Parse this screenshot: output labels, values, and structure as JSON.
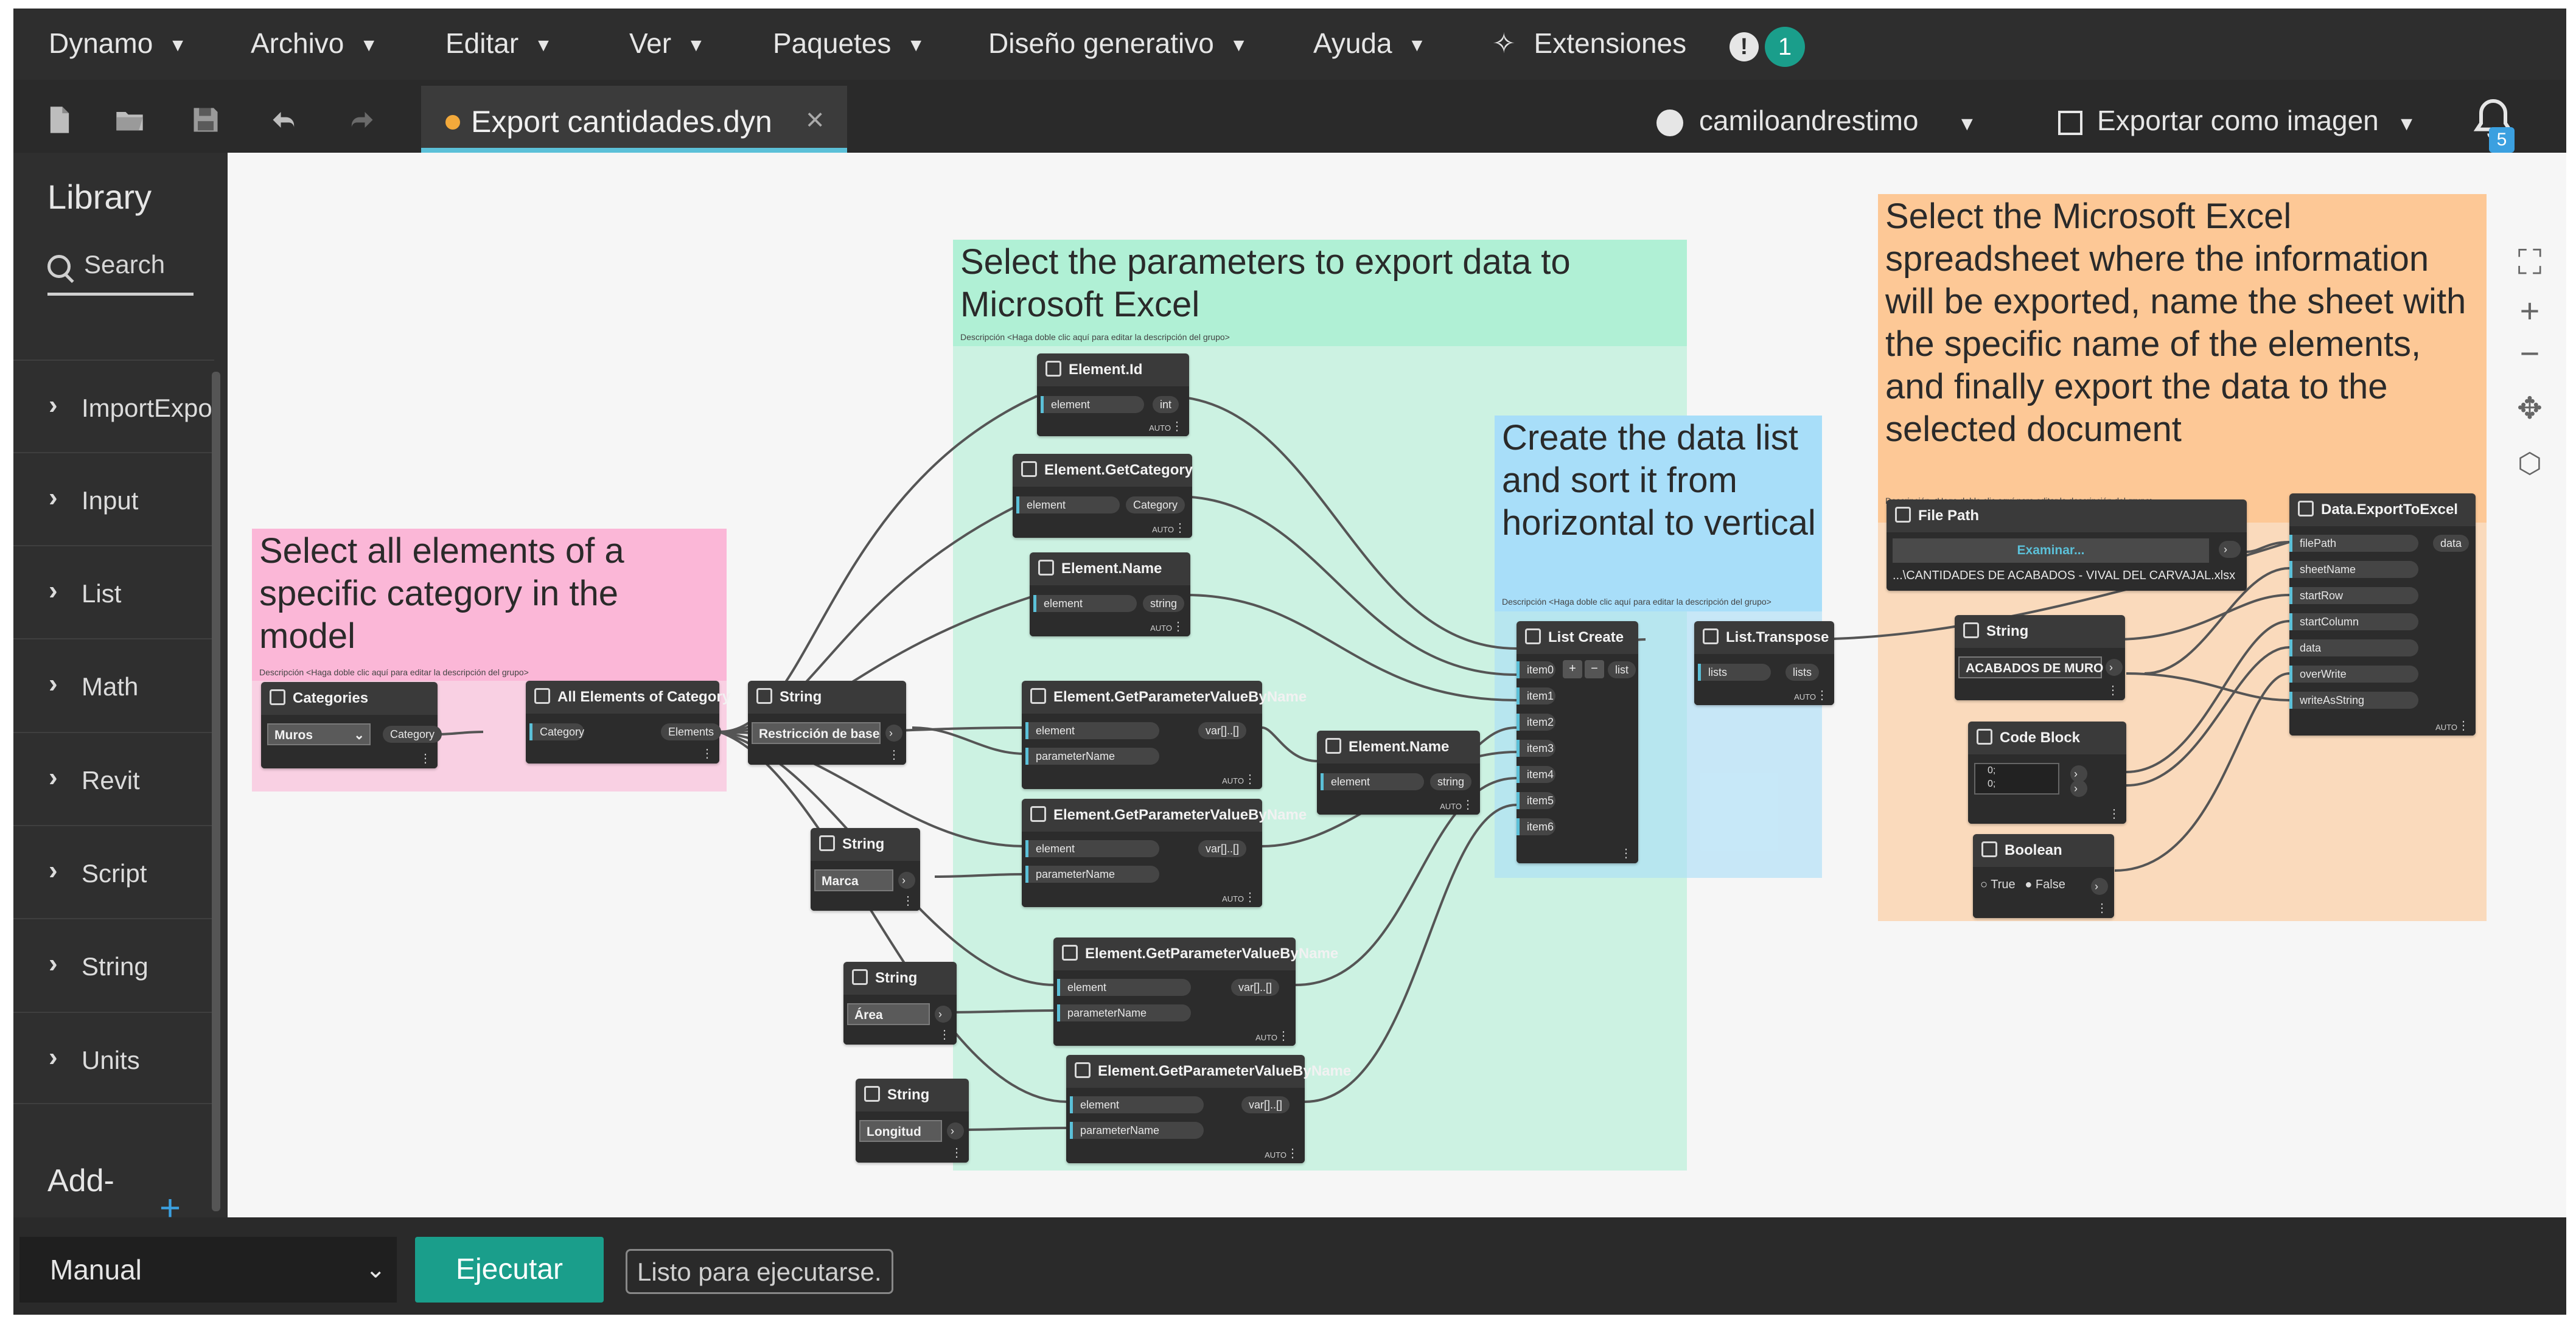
{
  "menu": {
    "items": [
      "Dynamo",
      "Archivo",
      "Editar",
      "Ver",
      "Paquetes",
      "Diseño generativo",
      "Ayuda"
    ],
    "extensions": "Extensiones",
    "alert_count": "1"
  },
  "toolbar": {
    "tab_title": "Export cantidades.dyn",
    "tab_close": "×",
    "user": "camiloandrestimo",
    "export_label": "Exportar como imagen",
    "notification_count": "5"
  },
  "library": {
    "title": "Library",
    "search_placeholder": "Search",
    "items": [
      "ImportExport",
      "Input",
      "List",
      "Math",
      "Revit",
      "Script",
      "String",
      "Units"
    ],
    "addons": "Add-"
  },
  "groups": {
    "select_category": {
      "title": "Select all elements of a specific category in the model",
      "desc": "Descripción <Haga doble clic aquí para editar la descripción del grupo>",
      "color": "#fbb7d7"
    },
    "parameters": {
      "title": "Select the parameters to export data to Microsoft Excel",
      "desc": "Descripción <Haga doble clic aquí para editar la descripción del grupo>",
      "color": "#b0f0d5"
    },
    "data_list": {
      "title": "Create the data list and sort it from horizontal to vertical",
      "desc": "Descripción <Haga doble clic aquí para editar la descripción del grupo>",
      "color": "#a8def9"
    },
    "excel": {
      "title": "Select the Microsoft Excel spreadsheet where the information will be exported, name the sheet with the specific name of the elements, and finally export the data to the selected document",
      "desc": "Descripción <Haga doble clic aquí para editar la descripción del grupo>",
      "color": "#fdc896"
    }
  },
  "nodes": {
    "categories": {
      "title": "Categories",
      "value": "Muros",
      "out": "Category"
    },
    "all_elements": {
      "title": "All Elements of Category",
      "in": "Category",
      "out": "Elements"
    },
    "string_restr": {
      "title": "String",
      "value": "Restricción de base"
    },
    "string_marca": {
      "title": "String",
      "value": "Marca"
    },
    "string_area": {
      "title": "String",
      "value": "Área"
    },
    "string_long": {
      "title": "String",
      "value": "Longitud"
    },
    "el_id": {
      "title": "Element.Id",
      "in": "element",
      "out": "int"
    },
    "el_cat": {
      "title": "Element.GetCategory",
      "in": "element",
      "out": "Category"
    },
    "el_name": {
      "title": "Element.Name",
      "in": "element",
      "out": "string"
    },
    "el_name2": {
      "title": "Element.Name",
      "in": "element",
      "out": "string"
    },
    "gp1": {
      "title": "Element.GetParameterValueByName",
      "in1": "element",
      "in2": "parameterName",
      "out": "var[]..[]"
    },
    "gp2": {
      "title": "Element.GetParameterValueByName",
      "in1": "element",
      "in2": "parameterName",
      "out": "var[]..[]"
    },
    "gp3": {
      "title": "Element.GetParameterValueByName",
      "in1": "element",
      "in2": "parameterName",
      "out": "var[]..[]"
    },
    "gp4": {
      "title": "Element.GetParameterValueByName",
      "in1": "element",
      "in2": "parameterName",
      "out": "var[]..[]"
    },
    "list_create": {
      "title": "List Create",
      "items": [
        "item0",
        "item1",
        "item2",
        "item3",
        "item4",
        "item5",
        "item6"
      ],
      "out": "list"
    },
    "list_transpose": {
      "title": "List.Transpose",
      "in": "lists",
      "out": "lists"
    },
    "file_path": {
      "title": "File Path",
      "button": "Examinar...",
      "path": "...\\CANTIDADES DE ACABADOS - VIVAL DEL CARVAJAL.xlsx"
    },
    "string_sheet": {
      "title": "String",
      "value": "ACABADOS DE MURO"
    },
    "code_block": {
      "title": "Code Block",
      "line1": "0;",
      "line2": "0;"
    },
    "boolean": {
      "title": "Boolean",
      "true": "True",
      "false": "False"
    },
    "export_excel": {
      "title": "Data.ExportToExcel",
      "inputs": [
        "filePath",
        "sheetName",
        "startRow",
        "startColumn",
        "data",
        "overWrite",
        "writeAsString"
      ],
      "out": "data"
    },
    "lacing": "AUTO"
  },
  "bottom": {
    "run_mode": "Manual",
    "run_button": "Ejecutar",
    "status": "Listo para ejecutarse."
  }
}
